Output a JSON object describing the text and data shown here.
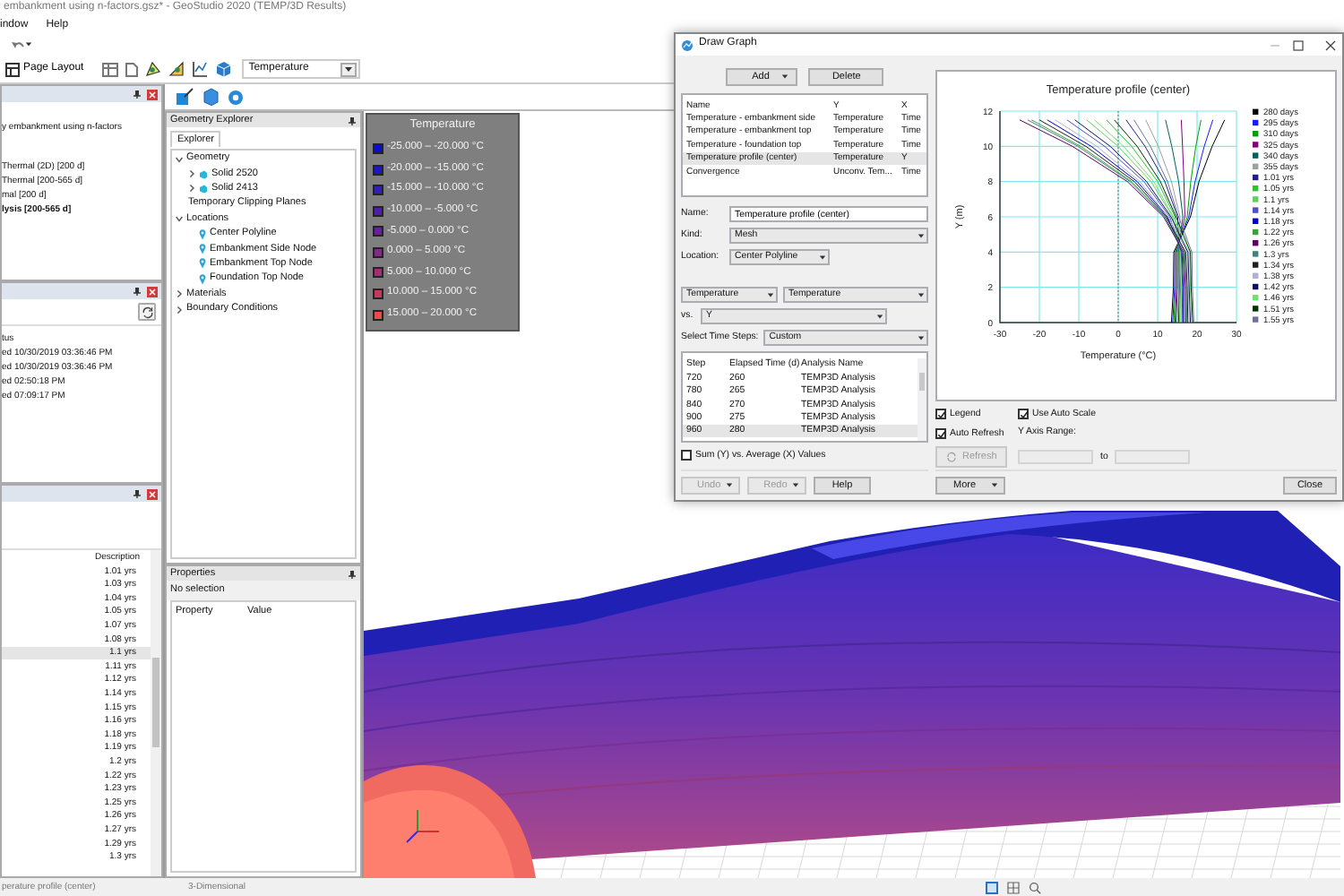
{
  "window": {
    "title": "embankment using n-factors.gsz* - GeoStudio 2020 (TEMP/3D Results)"
  },
  "menu": [
    {
      "label": "indow"
    },
    {
      "label": "Help"
    }
  ],
  "ribbon": {
    "page_layout": "Page Layout",
    "contour_dropdown": "Temperature"
  },
  "analyses_panel": {
    "project": "y embankment using n-factors",
    "analyses": [
      {
        "label": "Thermal (2D) [200 d]",
        "active": false
      },
      {
        "label": "Thermal [200-565 d]",
        "active": false
      },
      {
        "label": "mal [200 d]",
        "active": false
      },
      {
        "label": "lysis [200-565 d]",
        "active": true
      }
    ]
  },
  "status_panel": {
    "lines": [
      "tus",
      "ed 10/30/2019 03:36:46 PM",
      "ed 10/30/2019 03:36:46 PM",
      "ed 02:50:18 PM",
      "ed 07:09:17 PM"
    ]
  },
  "results_table": {
    "column": "Description",
    "rows": [
      {
        "description": "1.01 yrs",
        "selected": false
      },
      {
        "description": "1.03 yrs",
        "selected": false
      },
      {
        "description": "1.04 yrs",
        "selected": false
      },
      {
        "description": "1.05 yrs",
        "selected": false
      },
      {
        "description": "1.07 yrs",
        "selected": false
      },
      {
        "description": "1.08 yrs",
        "selected": false
      },
      {
        "description": "1.1 yrs",
        "selected": true
      },
      {
        "description": "1.11 yrs",
        "selected": false
      },
      {
        "description": "1.12 yrs",
        "selected": false
      },
      {
        "description": "1.14 yrs",
        "selected": false
      },
      {
        "description": "1.15 yrs",
        "selected": false
      },
      {
        "description": "1.16 yrs",
        "selected": false
      },
      {
        "description": "1.18 yrs",
        "selected": false
      },
      {
        "description": "1.19 yrs",
        "selected": false
      },
      {
        "description": "1.2 yrs",
        "selected": false
      },
      {
        "description": "1.22 yrs",
        "selected": false
      },
      {
        "description": "1.23 yrs",
        "selected": false
      },
      {
        "description": "1.25 yrs",
        "selected": false
      },
      {
        "description": "1.26 yrs",
        "selected": false
      },
      {
        "description": "1.27 yrs",
        "selected": false
      },
      {
        "description": "1.29 yrs",
        "selected": false
      },
      {
        "description": "1.3 yrs",
        "selected": false
      }
    ]
  },
  "geometry_explorer": {
    "title": "Geometry Explorer",
    "tab": "Explorer",
    "tree": [
      {
        "label": "Geometry",
        "expanded": true,
        "children": [
          {
            "label": "Solid 2520",
            "kind": "solid",
            "expanded": false
          },
          {
            "label": "Solid 2413",
            "kind": "solid",
            "expanded": false
          },
          {
            "label": "Temporary Clipping Planes",
            "kind": "plain"
          }
        ]
      },
      {
        "label": "Locations",
        "expanded": true,
        "children": [
          {
            "label": "Center Polyline",
            "kind": "location"
          },
          {
            "label": "Embankment Side Node",
            "kind": "location"
          },
          {
            "label": "Embankment Top Node",
            "kind": "location"
          },
          {
            "label": "Foundation Top Node",
            "kind": "location"
          }
        ]
      },
      {
        "label": "Materials",
        "expanded": false
      },
      {
        "label": "Boundary Conditions",
        "expanded": false
      }
    ]
  },
  "properties": {
    "title": "Properties",
    "selection": "No selection",
    "columns": [
      "Property",
      "Value"
    ]
  },
  "legend": {
    "title": "Temperature",
    "entries": [
      {
        "label": "-25.000 – -20.000 °C",
        "color": "#0a0ad0"
      },
      {
        "label": "-20.000 – -15.000 °C",
        "color": "#1c16c4"
      },
      {
        "label": "-15.000 – -10.000 °C",
        "color": "#3020b8"
      },
      {
        "label": "-10.000 – -5.000 °C",
        "color": "#4c1eaa"
      },
      {
        "label": "-5.000 – 0.000 °C",
        "color": "#66209c"
      },
      {
        "label": "0.000 – 5.000 °C",
        "color": "#84288c"
      },
      {
        "label": "5.000 – 10.000 °C",
        "color": "#a22e76"
      },
      {
        "label": "10.000 – 15.000 °C",
        "color": "#c4385a"
      },
      {
        "label": "15.000 – 20.000 °C",
        "color": "#e84c4c"
      }
    ]
  },
  "status_bar": {
    "left": "perature profile (center)",
    "view": "3-Dimensional"
  },
  "draw_graph": {
    "title": "Draw Graph",
    "add_button": {
      "label": "Add",
      "dropdown": true
    },
    "delete_button": {
      "label": "Delete"
    },
    "graphs": {
      "columns": [
        "Name",
        "Y",
        "X"
      ],
      "rows": [
        {
          "name": "Temperature - embankment side",
          "y": "Temperature",
          "x": "Time",
          "selected": false
        },
        {
          "name": "Temperature - embankment top",
          "y": "Temperature",
          "x": "Time",
          "selected": false
        },
        {
          "name": "Temperature - foundation top",
          "y": "Temperature",
          "x": "Time",
          "selected": false
        },
        {
          "name": "Temperature profile (center)",
          "y": "Temperature",
          "x": "Y",
          "selected": true
        },
        {
          "name": "Convergence",
          "y": "Unconv. Tem...",
          "x": "Time",
          "selected": false
        }
      ]
    },
    "name_label": "Name:",
    "name_value": "Temperature profile (center)",
    "kind_label": "Kind:",
    "kind": "Mesh",
    "location_label": "Location:",
    "location": "Center Polyline",
    "y_quantity": "Temperature",
    "y_subquantity": "Temperature",
    "vs_label": "vs.",
    "x_quantity": "Y",
    "time_steps_label": "Select Time Steps:",
    "time_steps": "Custom",
    "steps": {
      "columns": [
        "Step",
        "Elapsed Time (d)",
        "Analysis Name"
      ],
      "rows": [
        {
          "step": "720",
          "time": "260",
          "analysis": "TEMP3D Analysis",
          "selected": false
        },
        {
          "step": "780",
          "time": "265",
          "analysis": "TEMP3D Analysis",
          "selected": false
        },
        {
          "step": "840",
          "time": "270",
          "analysis": "TEMP3D Analysis",
          "selected": false
        },
        {
          "step": "900",
          "time": "275",
          "analysis": "TEMP3D Analysis",
          "selected": false
        },
        {
          "step": "960",
          "time": "280",
          "analysis": "TEMP3D Analysis",
          "selected": true
        }
      ]
    },
    "sum_checkbox": {
      "label": "Sum (Y) vs. Average (X) Values",
      "checked": false
    },
    "chart": {
      "chart_data": {
        "type": "line",
        "title": "Temperature profile (center)",
        "xlabel": "Temperature (°C)",
        "ylabel": "Y (m)",
        "orientation": "horizontal",
        "x": [
          0,
          2,
          4,
          6,
          8,
          10,
          11.5
        ],
        "grid": true,
        "legend": "right",
        "ref_lines": [
          {
            "axis": "x",
            "value": 0
          }
        ],
        "xlim": [
          -30,
          30
        ],
        "ylim": [
          0,
          12
        ],
        "xticks": [
          -30,
          -20,
          -10,
          0,
          10,
          20,
          30
        ],
        "yticks": [
          0,
          2,
          4,
          6,
          8,
          10,
          12
        ],
        "series": [
          {
            "name": "280 days",
            "color": "#000000",
            "values": [
              13.5,
              14,
              14.1,
              18.3,
              20.5,
              23.8,
              27
            ]
          },
          {
            "name": "295 days",
            "color": "#1a1aff",
            "values": [
              13.8,
              14.3,
              14.4,
              17.9,
              19.5,
              21.8,
              24
            ]
          },
          {
            "name": "310 days",
            "color": "#00a000",
            "values": [
              14.1,
              14.5,
              14.5,
              17.5,
              18.4,
              19.7,
              21
            ]
          },
          {
            "name": "325 days",
            "color": "#800080",
            "values": [
              14.4,
              14.8,
              14.8,
              16.9,
              16.7,
              16.3,
              16
            ]
          },
          {
            "name": "340 days",
            "color": "#006060",
            "values": [
              14.7,
              15,
              15,
              16.4,
              15.3,
              13.6,
              12
            ]
          },
          {
            "name": "355 days",
            "color": "#a0a0a0",
            "values": [
              15,
              15.3,
              15.2,
              15.7,
              13.5,
              10.2,
              7
            ]
          },
          {
            "name": "1.01 yrs",
            "color": "#202080",
            "values": [
              15.3,
              15.5,
              15.4,
              15.1,
              11.8,
              6.8,
              2
            ]
          },
          {
            "name": "1.05 yrs",
            "color": "#30c030",
            "values": [
              15.6,
              15.8,
              15.6,
              14.4,
              10,
              3.4,
              -3
            ]
          },
          {
            "name": "1.1 yrs",
            "color": "#60d060",
            "values": [
              15.9,
              16,
              15.8,
              13.8,
              8.3,
              0,
              -8
            ]
          },
          {
            "name": "1.14 yrs",
            "color": "#5050c0",
            "values": [
              16.2,
              16.3,
              16,
              13.1,
              6.5,
              -3.4,
              -13
            ]
          },
          {
            "name": "1.18 yrs",
            "color": "#0000c0",
            "values": [
              16.5,
              16.5,
              16.2,
              12.5,
              4.8,
              -6.8,
              -18
            ]
          },
          {
            "name": "1.22 yrs",
            "color": "#40a040",
            "values": [
              16.8,
              16.8,
              16.4,
              11.9,
              3.4,
              -9.5,
              -22
            ]
          },
          {
            "name": "1.26 yrs",
            "color": "#600060",
            "values": [
              17.1,
              17,
              16.6,
              11.5,
              2.3,
              -11.6,
              -25
            ]
          },
          {
            "name": "1.3 yrs",
            "color": "#408080",
            "values": [
              17.4,
              17.3,
              16.9,
              11.8,
              3,
              -10.2,
              -23
            ]
          },
          {
            "name": "1.34 yrs",
            "color": "#202020",
            "values": [
              17.7,
              17.5,
              17.1,
              12.2,
              4.1,
              -8.2,
              -20
            ]
          },
          {
            "name": "1.38 yrs",
            "color": "#b0b0d0",
            "values": [
              18,
              17.8,
              17.5,
              12.7,
              5.5,
              -5.4,
              -16
            ]
          },
          {
            "name": "1.42 yrs",
            "color": "#101060",
            "values": [
              18.3,
              18,
              17.7,
              13.4,
              7.2,
              -2,
              -11
            ]
          },
          {
            "name": "1.46 yrs",
            "color": "#70e070",
            "values": [
              18.6,
              18.3,
              18.1,
              14,
              9,
              1.4,
              -6
            ]
          },
          {
            "name": "1.51 yrs",
            "color": "#003300",
            "values": [
              18.9,
              18.5,
              18.3,
              14.7,
              10.7,
              4.8,
              -1
            ]
          },
          {
            "name": "1.55 yrs",
            "color": "#7070a0",
            "values": [
              19.2,
              18.8,
              18.7,
              15.3,
              12.5,
              8.2,
              4
            ]
          }
        ]
      }
    },
    "legend_checkbox": {
      "label": "Legend",
      "checked": true
    },
    "auto_scale_checkbox": {
      "label": "Use Auto Scale",
      "checked": true
    },
    "auto_refresh_checkbox": {
      "label": "Auto Refresh",
      "checked": true
    },
    "y_range": {
      "label": "Y Axis Range:",
      "to": "to",
      "disabled": true
    },
    "refresh_button": {
      "label": "Refresh",
      "disabled": true
    },
    "bottom_buttons": [
      {
        "label": "Undo",
        "dropdown": true,
        "disabled": true
      },
      {
        "label": "Redo",
        "dropdown": true,
        "disabled": true
      },
      {
        "label": "Help",
        "dropdown": false,
        "disabled": false
      }
    ],
    "more_button": {
      "label": "More",
      "dropdown": true
    },
    "close_button": {
      "label": "Close"
    }
  }
}
